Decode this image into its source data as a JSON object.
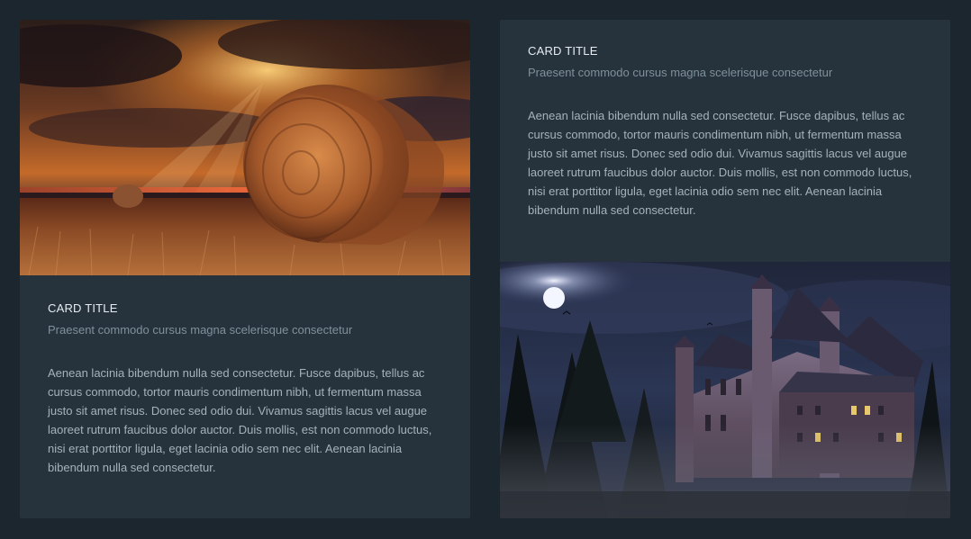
{
  "cards": [
    {
      "title": "CARD TITLE",
      "subtitle": "Praesent commodo cursus magna scelerisque consectetur",
      "text": "Aenean lacinia bibendum nulla sed consectetur. Fusce dapibus, tellus ac cursus commodo, tortor mauris condimentum nibh, ut fermentum massa justo sit amet risus. Donec sed odio dui. Vivamus sagittis lacus vel augue laoreet rutrum faucibus dolor auctor. Duis mollis, est non commodo luctus, nisi erat porttitor ligula, eget lacinia odio sem nec elit. Aenean lacinia bibendum nulla sed consectetur.",
      "image": "hay-bale-sunset-field"
    },
    {
      "title": "CARD TITLE",
      "subtitle": "Praesent commodo cursus magna scelerisque consectetur",
      "text": "Aenean lacinia bibendum nulla sed consectetur. Fusce dapibus, tellus ac cursus commodo, tortor mauris condimentum nibh, ut fermentum massa justo sit amet risus. Donec sed odio dui. Vivamus sagittis lacus vel augue laoreet rutrum faucibus dolor auctor. Duis mollis, est non commodo luctus, nisi erat porttitor ligula, eget lacinia odio sem nec elit. Aenean lacinia bibendum nulla sed consectetur.",
      "image": "haunted-castle-night"
    }
  ],
  "colors": {
    "page_background": "#1c262e",
    "card_background": "#26333d",
    "title": "#e6edf2",
    "subtitle": "#7f909b",
    "body_text": "#a5b2bb"
  }
}
